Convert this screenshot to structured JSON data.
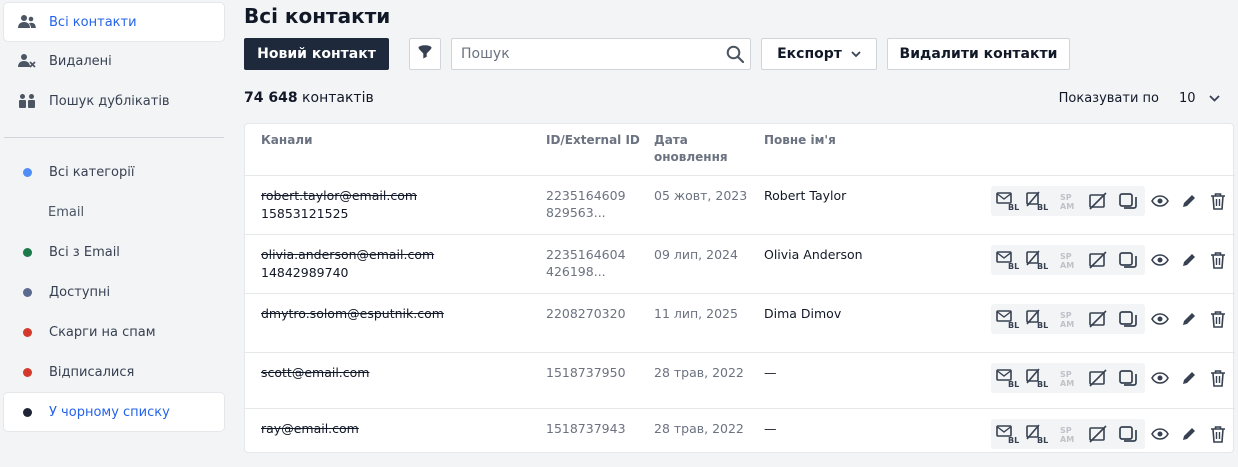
{
  "sidebar": {
    "top_items": [
      {
        "label": "Всі контакти",
        "icon": "users-icon",
        "active": true
      },
      {
        "label": "Видалені",
        "icon": "user-remove-icon",
        "active": false
      },
      {
        "label": "Пошук дублікатів",
        "icon": "duplicates-icon",
        "active": false
      }
    ],
    "categories": [
      {
        "label": "Всі категорії",
        "color": "#4f8ef7"
      },
      {
        "label": "Всі з Email",
        "color": "#1a7a4a"
      },
      {
        "label": "Доступні",
        "color": "#5b6b8f"
      },
      {
        "label": "Скарги на спам",
        "color": "#d33a2c"
      },
      {
        "label": "Відписалися",
        "color": "#d33a2c"
      },
      {
        "label": "У чорному списку",
        "color": "#1f2537"
      }
    ],
    "sub_label": "Email"
  },
  "header": {
    "title": "Всі контакти",
    "new_contact": "Новий контакт",
    "search_placeholder": "Пошук",
    "export": "Експорт",
    "delete_contacts": "Видалити контакти"
  },
  "summary": {
    "count": "74 648",
    "count_label": " контактів",
    "per_page_label": "Показувати по",
    "per_page_value": "10"
  },
  "table": {
    "columns": [
      "Канали",
      "ID/External ID",
      "Дата\nоновлення",
      "Повне ім'я"
    ],
    "rows": [
      {
        "email": "robert.taylor@email.com",
        "phone": "15853121525",
        "id1": "2235164609",
        "id2": "829563...",
        "date": "05 жовт, 2023",
        "name": "Robert Taylor"
      },
      {
        "email": "olivia.anderson@email.com",
        "phone": "14842989740",
        "id1": "2235164604",
        "id2": "426198...",
        "date": "09 лип, 2024",
        "name": "Olivia Anderson"
      },
      {
        "email": "dmytro.solom@esputnik.com",
        "phone": "",
        "id1": "2208270320",
        "id2": "",
        "date": "11 лип, 2025",
        "name": "Dima Dimov"
      },
      {
        "email": "scott@email.com",
        "phone": "",
        "id1": "1518737950",
        "id2": "",
        "date": "28 трав, 2022",
        "name": "—"
      },
      {
        "email": "ray@email.com",
        "phone": "",
        "id1": "1518737943",
        "id2": "",
        "date": "28 трав, 2022",
        "name": "—"
      }
    ]
  },
  "colors": {
    "primary_button": "#1e2a3b",
    "accent": "#2563eb"
  }
}
